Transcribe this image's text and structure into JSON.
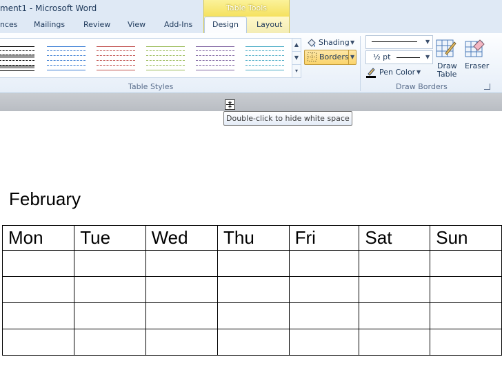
{
  "window": {
    "title": "ment1  -  Microsoft Word"
  },
  "ribbon": {
    "context_group": "Table Tools",
    "tabs": [
      {
        "label": "nces"
      },
      {
        "label": "Mailings"
      },
      {
        "label": "Review"
      },
      {
        "label": "View"
      },
      {
        "label": "Add-Ins"
      },
      {
        "label": "Design"
      },
      {
        "label": "Layout"
      }
    ],
    "active_tab": "Design",
    "groups": {
      "table_styles": "Table Styles",
      "draw_borders": "Draw Borders"
    },
    "commands": {
      "shading": "Shading",
      "borders": "Borders",
      "weight": "½ pt",
      "pen_color": "Pen Color",
      "draw_table_line1": "Draw",
      "draw_table_line2": "Table",
      "eraser": "Eraser"
    },
    "style_colors": [
      "#000000",
      "#3d7fd4",
      "#c0504d",
      "#9bbb59",
      "#8064a2",
      "#4bacc6"
    ]
  },
  "tooltip": {
    "text": "Double-click to hide white space"
  },
  "document": {
    "heading": "February",
    "table": {
      "headers": [
        "Mon",
        "Tue",
        "Wed",
        "Thu",
        "Fri",
        "Sat",
        "Sun"
      ],
      "rows": [
        [
          "",
          "",
          "",
          "",
          "",
          "",
          ""
        ],
        [
          "",
          "",
          "",
          "",
          "",
          "",
          ""
        ],
        [
          "",
          "",
          "",
          "",
          "",
          "",
          ""
        ],
        [
          "",
          "",
          "",
          "",
          "",
          "",
          ""
        ]
      ]
    }
  }
}
